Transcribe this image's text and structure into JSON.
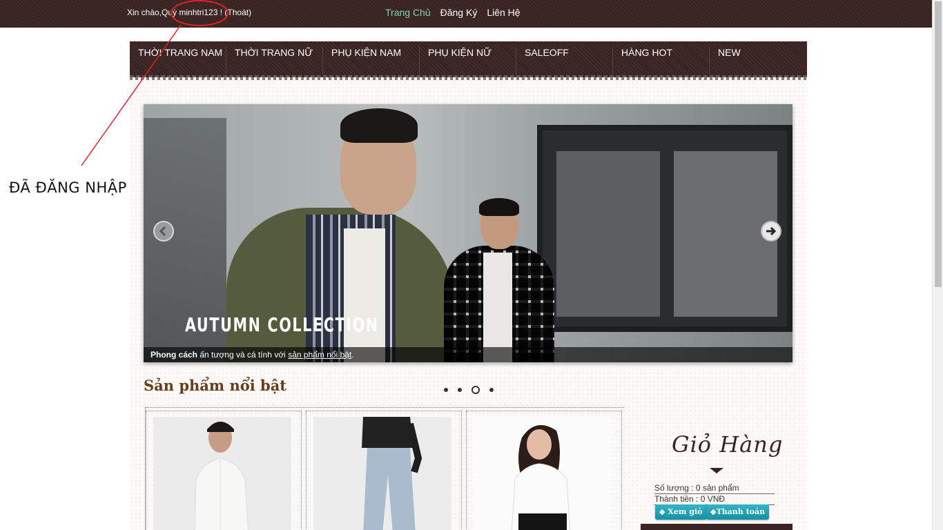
{
  "topbar": {
    "greeting": "Xin chào,Quý minhtri123 ! (Thoát)",
    "links": [
      {
        "label": "Trang Chủ",
        "active": true
      },
      {
        "label": "Đăng Ký",
        "active": false
      },
      {
        "label": "Liên Hệ",
        "active": false
      }
    ]
  },
  "menu": {
    "items": [
      {
        "label": "THỜI TRANG NAM"
      },
      {
        "label": "THỜI TRANG NỮ"
      },
      {
        "label": "PHỤ KIỆN NAM"
      },
      {
        "label": "PHỤ KIỆN NỮ"
      },
      {
        "label": "SALEOFF"
      },
      {
        "label": "HÀNG HOT"
      },
      {
        "label": "NEW"
      }
    ]
  },
  "slider": {
    "title": "AUTUMN COLLECTION",
    "caption_bold": "Phong cách",
    "caption_mid": " ấn tượng và cá tính với ",
    "caption_link": "sản phẩm nổi bật",
    "caption_end": ".",
    "dots_count": 4,
    "active_dot": 3
  },
  "featured": {
    "title": "Sản phẩm nổi bật"
  },
  "cart": {
    "title": "Giỏ Hàng",
    "quantity": "Số lượng : 0 sản phẩm",
    "total": "Thành tiền : 0 VNĐ",
    "view_btn": "Xem giỏ",
    "pay_btn": "Thanh toán"
  },
  "annotation": {
    "text": "ĐÃ ĐĂNG NHẬP",
    "color": "#e0202a"
  },
  "colors": {
    "brand_dark": "#3a2320",
    "active_link": "#7fd4b6",
    "section_title": "#6a3d1a",
    "cart_button": "#1fa3b6"
  }
}
